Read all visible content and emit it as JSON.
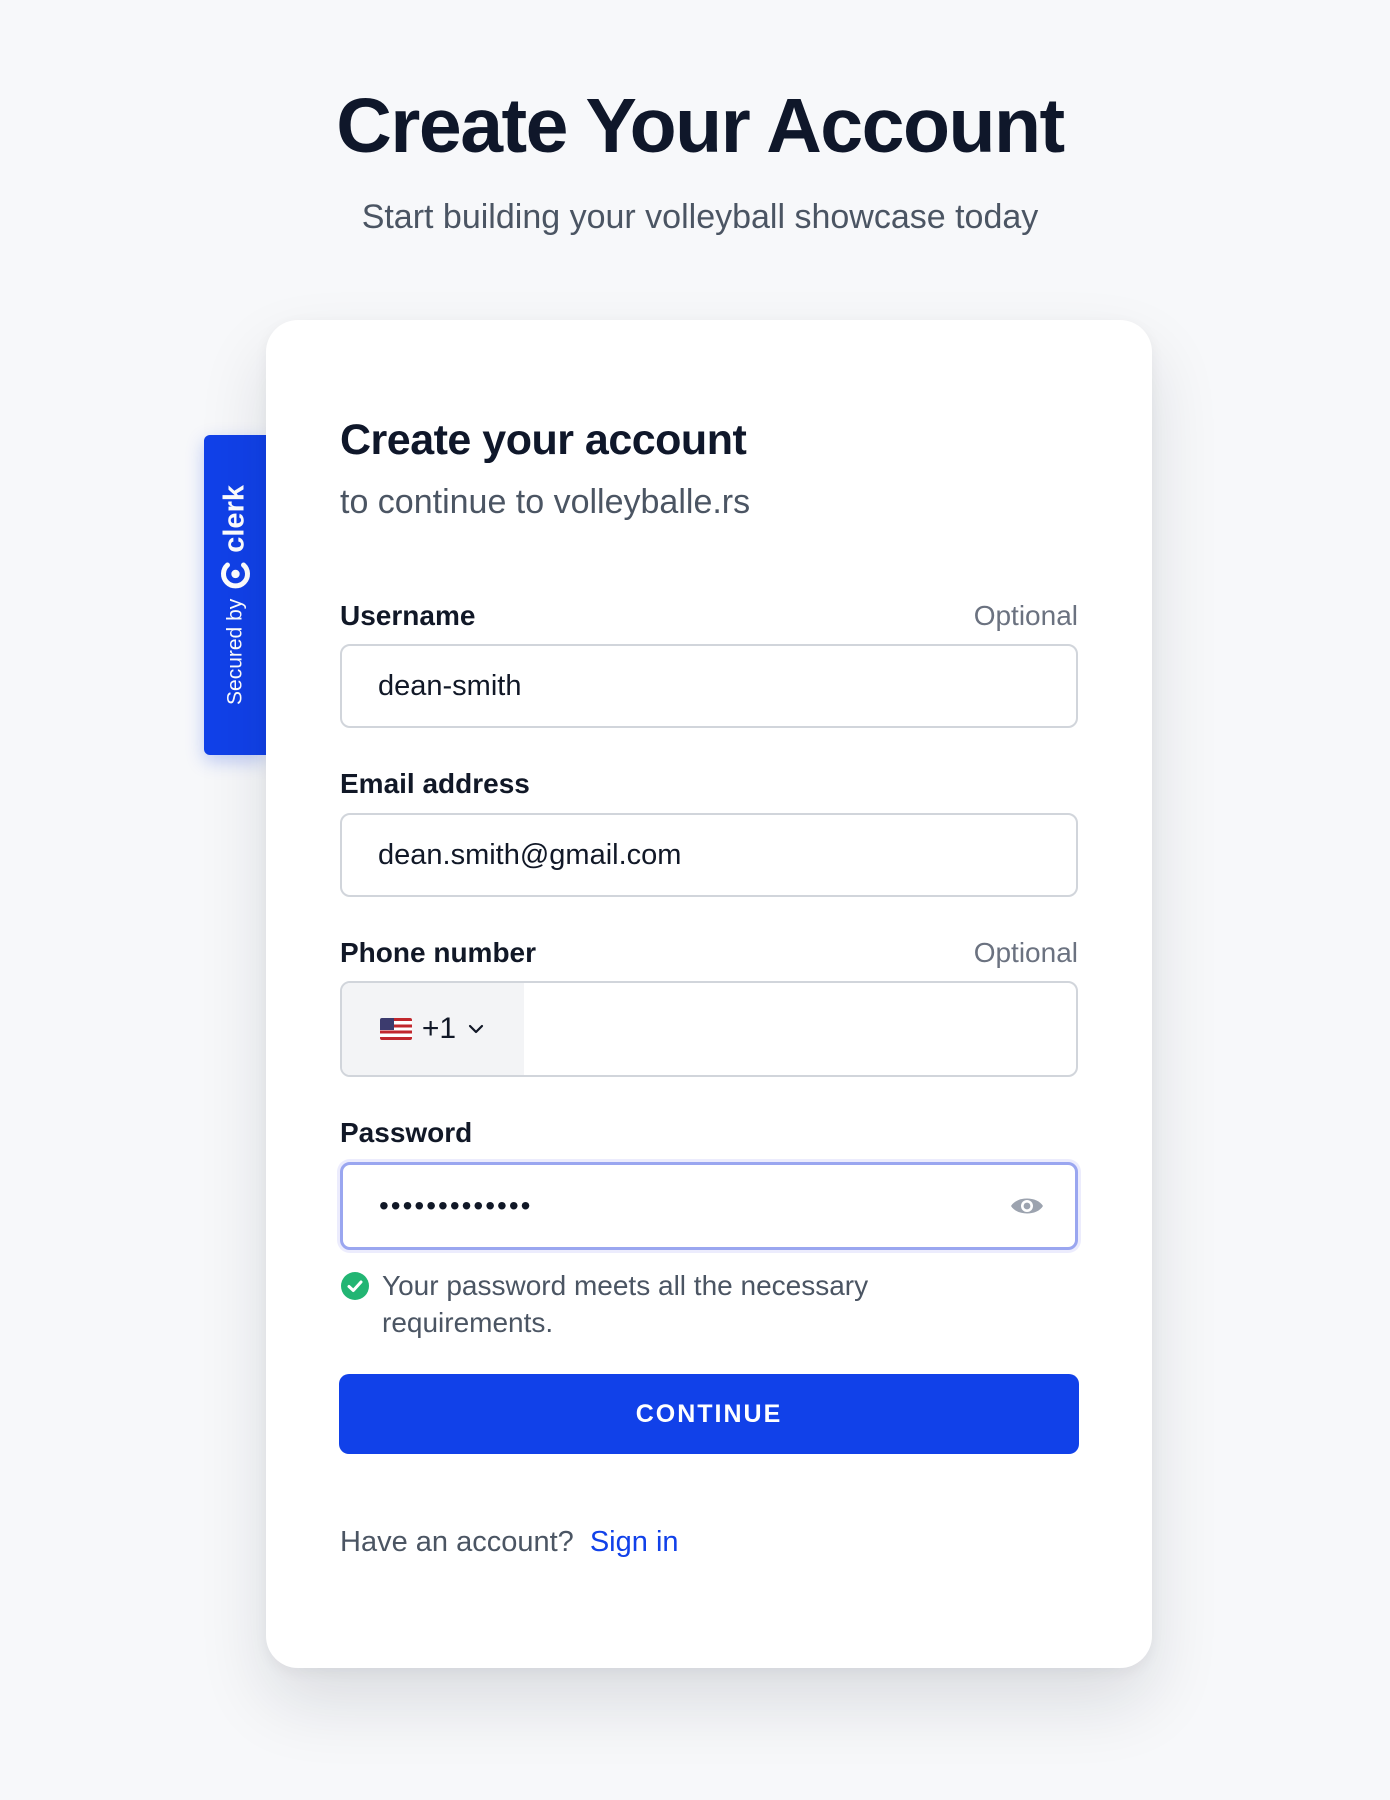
{
  "page": {
    "title": "Create Your Account",
    "subtitle": "Start building your volleyball showcase today"
  },
  "badge": {
    "secured_by": "Secured by",
    "brand": "clerk"
  },
  "card": {
    "title": "Create your account",
    "subtitle": "to continue to volleyballe.rs"
  },
  "form": {
    "username": {
      "label": "Username",
      "optional": "Optional",
      "value": "dean-smith"
    },
    "email": {
      "label": "Email address",
      "value": "dean.smith@gmail.com"
    },
    "phone": {
      "label": "Phone number",
      "optional": "Optional",
      "country_code": "+1",
      "flag": "us-flag-icon",
      "value": ""
    },
    "password": {
      "label": "Password",
      "masked_value": "•••••••••••••",
      "hint": "Your password meets all the necessary requirements."
    },
    "submit_label": "CONTINUE"
  },
  "footer": {
    "prompt": "Have an account?",
    "link": "Sign in"
  },
  "colors": {
    "accent": "#1141e9",
    "success": "#22b573",
    "background": "#f7f8fa"
  }
}
